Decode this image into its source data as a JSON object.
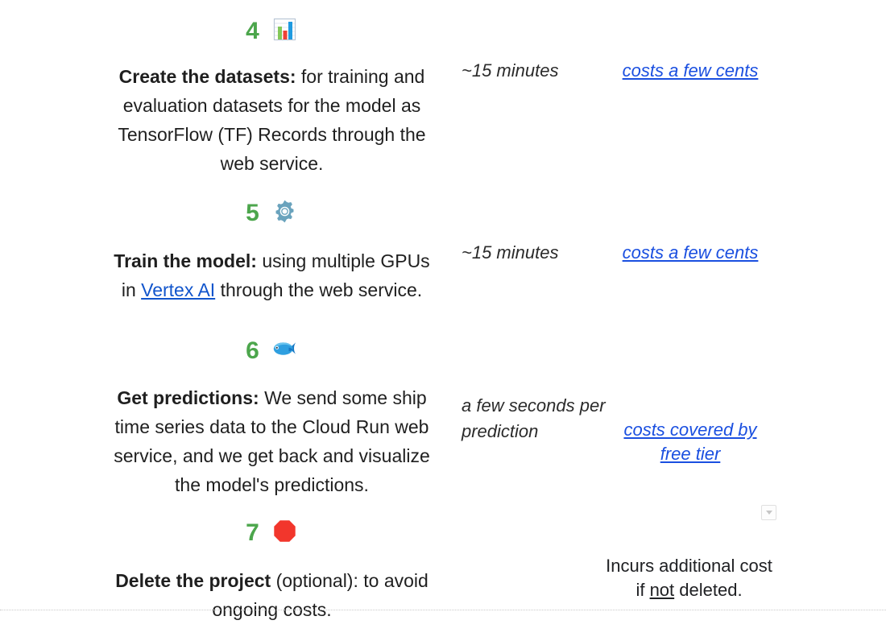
{
  "document": {
    "background_color": "#ffffff",
    "accent_number_color": "#4ca64c",
    "link_color": "#1a4fe0",
    "inline_link_color": "#1155cc"
  },
  "steps": [
    {
      "number": "4",
      "icon": "bar-chart-emoji",
      "title": "Create the datasets:",
      "body": " for training and evaluation datasets for the model as TensorFlow (TF) Records  through the web service.",
      "time": "~15 minutes",
      "cost": "costs a few cents"
    },
    {
      "number": "5",
      "icon": "gear-emoji",
      "title": "Train the model:",
      "body_before_link": " using multiple GPUs in ",
      "link_text": "Vertex AI",
      "body_after_link": " through the web service.",
      "time": "~15 minutes",
      "cost": "costs a few cents"
    },
    {
      "number": "6",
      "icon": "fish-emoji",
      "title": "Get predictions:",
      "body": " We send some ship time series data to the Cloud Run web service, and we get back and visualize the model's predictions.",
      "time": "a few seconds per prediction",
      "cost": "costs covered by free tier"
    },
    {
      "number": "7",
      "icon": "stop-sign-emoji",
      "title": "Delete the project",
      "body": " (optional): to avoid ongoing costs.",
      "note_before": "Incurs additional cost if ",
      "note_emphasis": "not",
      "note_after": " deleted."
    }
  ],
  "controls": {
    "dropdown_toggle": "chevron-down-icon"
  }
}
